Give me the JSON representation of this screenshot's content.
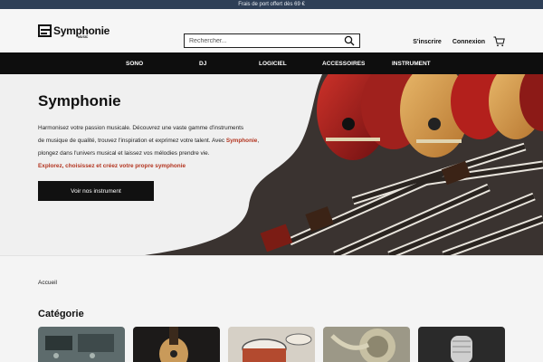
{
  "topbar": {
    "text": "Frais de port offert dès 69 €"
  },
  "header": {
    "logo_text": "Symphonie",
    "logo_sub": "MUSIC",
    "search_placeholder": "Rechercher...",
    "signup": "S'inscrire",
    "login": "Connexion"
  },
  "menu": {
    "items": [
      "SONO",
      "DJ",
      "LOGICIEL",
      "ACCESSOIRES",
      "INSTRUMENT"
    ]
  },
  "hero": {
    "title": "Symphonie",
    "line1": "Harmonisez votre passion musicale. Découvrez une vaste gamme d'instruments",
    "line2a": "de musique de qualité, trouvez l'inspiration et exprimez votre talent. Avec ",
    "line2b": "Symphonie",
    "line2c": ",",
    "line3": "plongez dans l'univers musical et laissez vos mélodies prendre vie.",
    "cta_text": "Explorez, choisissez et créez votre propre symphonie",
    "button": "Voir nos instrument"
  },
  "breadcrumb": "Accueil",
  "category": {
    "title": "Catégorie"
  },
  "colors": {
    "accent": "#b3341f",
    "topbar": "#2e3f57",
    "nav": "#0e0e0e"
  }
}
